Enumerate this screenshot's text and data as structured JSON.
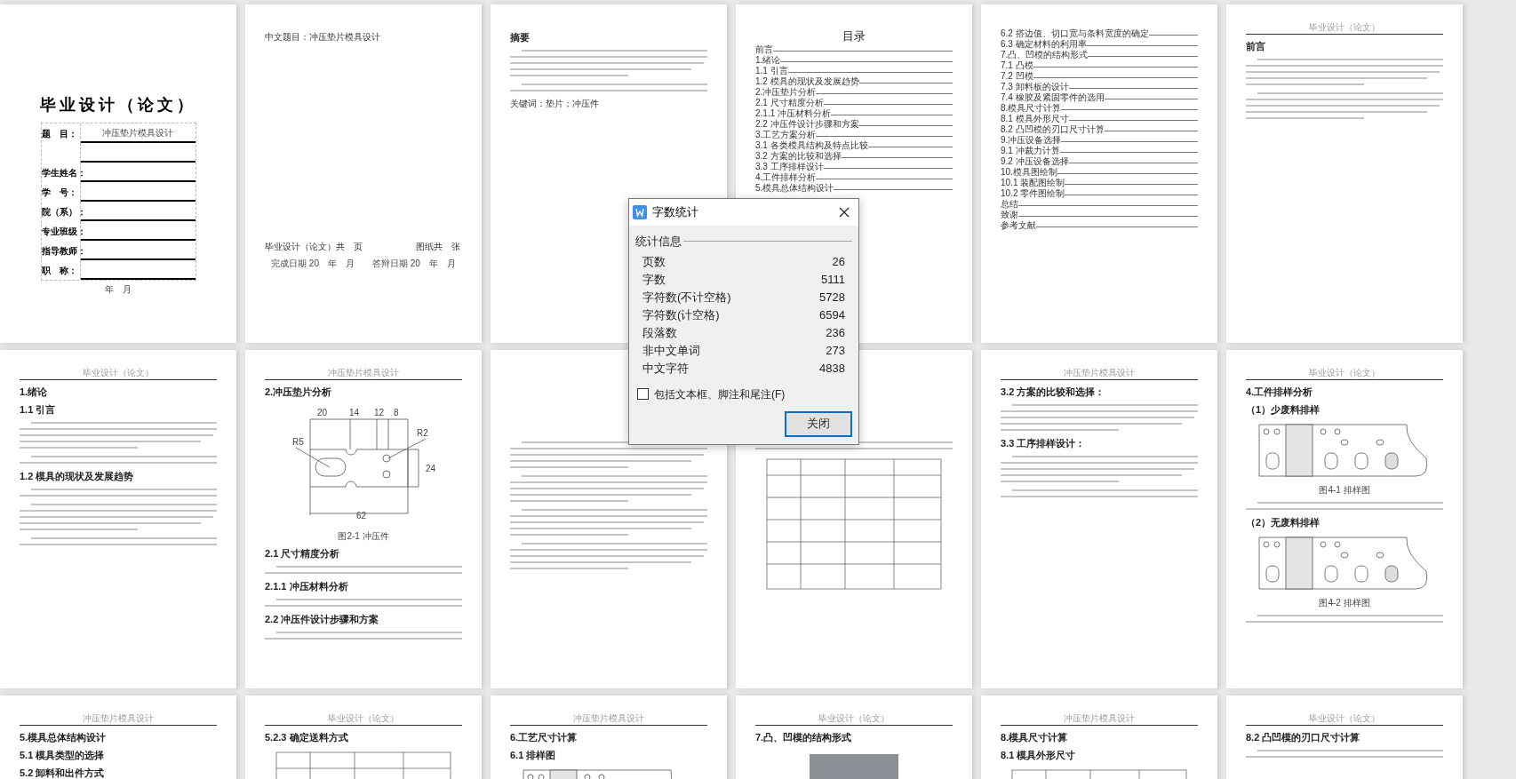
{
  "pages": [
    {
      "blocks": [
        {
          "kind": "gap"
        },
        {
          "kind": "title",
          "text": "毕业设计（论文）"
        },
        {
          "kind": "form",
          "rows": [
            {
              "label": "题　目：",
              "value": "冲压垫片模具设计"
            },
            {},
            {
              "label": "学生姓名："
            },
            {
              "label": "学　号："
            },
            {
              "label": "院（系）："
            },
            {
              "label": "专业班级："
            },
            {
              "label": "指导教师："
            },
            {
              "label": "职　称："
            }
          ]
        },
        {
          "kind": "caption",
          "text": "年　月"
        }
      ]
    },
    {
      "blocks": [
        {
          "kind": "text",
          "text": "中文题目：冲压垫片模具设计"
        },
        {
          "kind": "gap"
        },
        {
          "kind": "gap"
        },
        {
          "kind": "gap"
        },
        {
          "kind": "text",
          "text": "毕业设计（论文）共　页　　　　　　图纸共　张"
        },
        {
          "kind": "caption",
          "text": "完成日期 20　年　月　　答辩日期 20　年　月"
        }
      ]
    },
    {
      "blocks": [
        {
          "kind": "heading",
          "text": "摘要"
        },
        {
          "kind": "para"
        },
        {
          "kind": "short"
        },
        {
          "kind": "text",
          "text": "关键词：垫片；冲压件"
        }
      ]
    },
    {
      "blocks": [
        {
          "kind": "center",
          "text": "目录"
        },
        {
          "kind": "toc",
          "text": "前言"
        },
        {
          "kind": "toc",
          "text": "1.绪论"
        },
        {
          "kind": "toc",
          "text": "1.1 引言"
        },
        {
          "kind": "toc",
          "text": "1.2 模具的现状及发展趋势"
        },
        {
          "kind": "toc",
          "text": "2.冲压垫片分析"
        },
        {
          "kind": "toc",
          "text": "2.1 尺寸精度分析"
        },
        {
          "kind": "toc",
          "text": "2.1.1 冲压材料分析"
        },
        {
          "kind": "toc",
          "text": "2.2 冲压件设计步骤和方案"
        },
        {
          "kind": "toc",
          "text": "3.工艺方案分析"
        },
        {
          "kind": "toc",
          "text": "3.1 各类模具结构及特点比较"
        },
        {
          "kind": "toc",
          "text": "3.2 方案的比较和选择"
        },
        {
          "kind": "toc",
          "text": "3.3 工序排样设计"
        },
        {
          "kind": "toc",
          "text": "4.工件排样分析"
        },
        {
          "kind": "toc",
          "text": "5.模具总体结构设计"
        }
      ]
    },
    {
      "blocks": [
        {
          "kind": "toc",
          "text": "6.2 搭边值、切口宽与条料宽度的确定"
        },
        {
          "kind": "toc",
          "text": "6.3 确定材料的利用率"
        },
        {
          "kind": "toc",
          "text": "7.凸、凹模的结构形式"
        },
        {
          "kind": "toc",
          "text": "7.1 凸模"
        },
        {
          "kind": "toc",
          "text": "7.2 凹模"
        },
        {
          "kind": "toc",
          "text": "7.3 卸料板的设计"
        },
        {
          "kind": "toc",
          "text": "7.4 橡胶及紧固零件的选用"
        },
        {
          "kind": "toc",
          "text": "8.模具尺寸计算"
        },
        {
          "kind": "toc",
          "text": "8.1 模具外形尺寸"
        },
        {
          "kind": "toc",
          "text": "8.2 凸凹模的刃口尺寸计算"
        },
        {
          "kind": "toc",
          "text": "9.冲压设备选择"
        },
        {
          "kind": "toc",
          "text": "9.1 冲裁力计算"
        },
        {
          "kind": "toc",
          "text": "9.2 冲压设备选择"
        },
        {
          "kind": "toc",
          "text": "10.模具图绘制"
        },
        {
          "kind": "toc",
          "text": "10.1 装配图绘制"
        },
        {
          "kind": "toc",
          "text": "10.2 零件图绘制"
        },
        {
          "kind": "toc",
          "text": "总结"
        },
        {
          "kind": "toc",
          "text": "致谢"
        },
        {
          "kind": "toc",
          "text": "参考文献"
        }
      ]
    },
    {
      "header": "毕业设计（论文）",
      "blocks": [
        {
          "kind": "heading",
          "text": "前言"
        },
        {
          "kind": "para"
        },
        {
          "kind": "para"
        }
      ]
    },
    {
      "header": "毕业设计（论文）",
      "blocks": [
        {
          "kind": "heading",
          "text": "1.绪论"
        },
        {
          "kind": "heading",
          "text": "1.1 引言"
        },
        {
          "kind": "para"
        },
        {
          "kind": "short"
        },
        {
          "kind": "heading",
          "text": "1.2 模具的现状及发展趋势"
        },
        {
          "kind": "short"
        },
        {
          "kind": "para"
        },
        {
          "kind": "short"
        }
      ]
    },
    {
      "header": "冲压垫片模具设计",
      "blocks": [
        {
          "kind": "heading",
          "text": "2.冲压垫片分析"
        },
        {
          "kind": "part",
          "labels": [
            "20",
            "14",
            "12",
            "8",
            "R5",
            "R2",
            "24",
            "62"
          ]
        },
        {
          "kind": "caption",
          "text": "图2-1 冲压件"
        },
        {
          "kind": "heading",
          "text": "2.1 尺寸精度分析"
        },
        {
          "kind": "short"
        },
        {
          "kind": "heading",
          "text": "2.1.1 冲压材料分析"
        },
        {
          "kind": "short"
        },
        {
          "kind": "heading",
          "text": "2.2 冲压件设计步骤和方案"
        },
        {
          "kind": "short"
        }
      ]
    },
    {
      "blocks": [
        {
          "kind": "gap"
        },
        {
          "kind": "para"
        },
        {
          "kind": "para"
        },
        {
          "kind": "para"
        },
        {
          "kind": "para"
        }
      ]
    },
    {
      "blocks": [
        {
          "kind": "gap"
        },
        {
          "kind": "short"
        },
        {
          "kind": "table"
        }
      ]
    },
    {
      "header": "冲压垫片模具设计",
      "blocks": [
        {
          "kind": "heading",
          "text": "3.2 方案的比较和选择："
        },
        {
          "kind": "para"
        },
        {
          "kind": "heading",
          "text": "3.3 工序排样设计："
        },
        {
          "kind": "para"
        },
        {
          "kind": "short"
        }
      ]
    },
    {
      "header": "毕业设计（论文）",
      "blocks": [
        {
          "kind": "heading",
          "text": "4.工件排样分析"
        },
        {
          "kind": "heading",
          "text": "（1）少废料排样"
        },
        {
          "kind": "strip"
        },
        {
          "kind": "caption",
          "text": "图4-1 排样图"
        },
        {
          "kind": "short"
        },
        {
          "kind": "heading",
          "text": "（2）无废料排样"
        },
        {
          "kind": "strip"
        },
        {
          "kind": "caption",
          "text": "图4-2 排样图"
        },
        {
          "kind": "short"
        }
      ]
    },
    {
      "header": "冲压垫片模具设计",
      "blocks": [
        {
          "kind": "heading",
          "text": "5.模具总体结构设计"
        },
        {
          "kind": "heading",
          "text": "5.1 模具类型的选择"
        },
        {
          "kind": "heading",
          "text": "5.2 卸料和出件方式"
        }
      ]
    },
    {
      "header": "毕业设计（论文）",
      "blocks": [
        {
          "kind": "heading",
          "text": "5.2.3 确定送料方式"
        },
        {
          "kind": "table"
        }
      ]
    },
    {
      "header": "冲压垫片模具设计",
      "blocks": [
        {
          "kind": "heading",
          "text": "6.工艺尺寸计算"
        },
        {
          "kind": "heading",
          "text": "6.1 排样图"
        },
        {
          "kind": "strip"
        }
      ]
    },
    {
      "header": "毕业设计（论文）",
      "blocks": [
        {
          "kind": "heading",
          "text": "7.凸、凹模的结构形式"
        },
        {
          "kind": "mold"
        }
      ]
    },
    {
      "header": "冲压垫片模具设计",
      "blocks": [
        {
          "kind": "heading",
          "text": "8.模具尺寸计算"
        },
        {
          "kind": "heading",
          "text": "8.1 模具外形尺寸"
        },
        {
          "kind": "table"
        }
      ]
    },
    {
      "header": "毕业设计（论文）",
      "blocks": [
        {
          "kind": "heading",
          "text": "8.2 凸凹模的刃口尺寸计算"
        },
        {
          "kind": "short"
        }
      ]
    }
  ],
  "dialog": {
    "title": "字数统计",
    "section": "统计信息",
    "stats": [
      {
        "label": "页数",
        "value": "26"
      },
      {
        "label": "字数",
        "value": "5111"
      },
      {
        "label": "字符数(不计空格)",
        "value": "5728"
      },
      {
        "label": "字符数(计空格)",
        "value": "6594"
      },
      {
        "label": "段落数",
        "value": "236"
      },
      {
        "label": "非中文单词",
        "value": "273"
      },
      {
        "label": "中文字符",
        "value": "4838"
      }
    ],
    "checkbox": {
      "label": "包括文本框、脚注和尾注(F)",
      "checked": false
    },
    "button": "关闭"
  }
}
